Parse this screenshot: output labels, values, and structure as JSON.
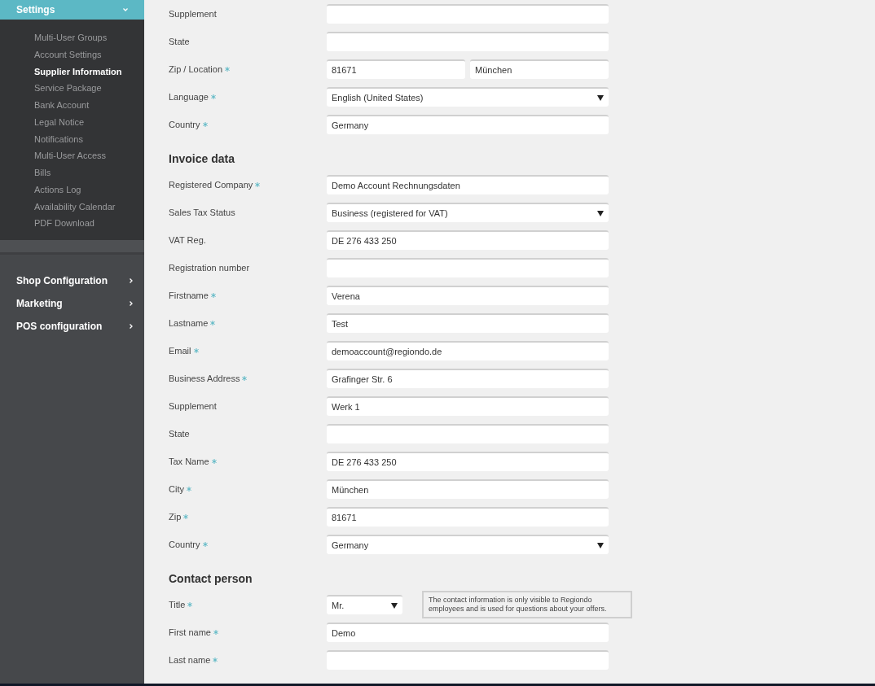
{
  "sidebar": {
    "header": {
      "label": "Settings",
      "expanded": true
    },
    "subitems": [
      {
        "label": "Multi-User Groups",
        "selected": false
      },
      {
        "label": "Account Settings",
        "selected": false
      },
      {
        "label": "Supplier Information",
        "selected": true
      },
      {
        "label": "Service Package",
        "selected": false
      },
      {
        "label": "Bank Account",
        "selected": false
      },
      {
        "label": "Legal Notice",
        "selected": false
      },
      {
        "label": "Notifications",
        "selected": false
      },
      {
        "label": "Multi-User Access",
        "selected": false
      },
      {
        "label": "Bills",
        "selected": false
      },
      {
        "label": "Actions Log",
        "selected": false
      },
      {
        "label": "Availability Calendar",
        "selected": false
      },
      {
        "label": "PDF Download",
        "selected": false
      }
    ],
    "menu": [
      {
        "label": "Shop Configuration",
        "expanded": false
      },
      {
        "label": "Marketing",
        "expanded": false
      },
      {
        "label": "POS configuration",
        "expanded": false
      }
    ]
  },
  "sections": [
    {
      "rows": [
        {
          "kind": "text",
          "label": "Supplement",
          "required": false
        },
        {
          "kind": "text",
          "label": "State",
          "required": false
        },
        {
          "kind": "split",
          "label": "Zip / Location",
          "required": true,
          "values": [
            "81671",
            "München"
          ]
        },
        {
          "kind": "select",
          "label": "Language",
          "required": true,
          "value": "English (United States)"
        },
        {
          "kind": "text",
          "label": "Country",
          "required": true,
          "value": "Germany"
        }
      ]
    },
    {
      "heading": "Invoice data",
      "rows": [
        {
          "kind": "text",
          "label": "Registered Company",
          "required": true,
          "value": "Demo Account Rechnungsdaten"
        },
        {
          "kind": "select",
          "label": "Sales Tax Status",
          "required": false,
          "value": "Business (registered for VAT)"
        },
        {
          "kind": "text",
          "label": "VAT Reg.",
          "required": false,
          "value": "DE 276 433 250"
        },
        {
          "kind": "text",
          "label": "Registration number",
          "required": false
        },
        {
          "kind": "text",
          "label": "Firstname",
          "required": true,
          "value": "Verena"
        },
        {
          "kind": "text",
          "label": "Lastname",
          "required": true,
          "value": "Test"
        },
        {
          "kind": "text",
          "label": "Email",
          "required": true,
          "value": "demoaccount@regiondo.de"
        },
        {
          "kind": "text",
          "label": "Business Address",
          "required": true,
          "value": "Grafinger Str. 6"
        },
        {
          "kind": "text",
          "label": "Supplement",
          "required": false,
          "value": "Werk 1"
        },
        {
          "kind": "text",
          "label": "State",
          "required": false
        },
        {
          "kind": "text",
          "label": "Tax Name",
          "required": true,
          "value": "DE 276 433 250"
        },
        {
          "kind": "text",
          "label": "City",
          "required": true,
          "value": "München"
        },
        {
          "kind": "text",
          "label": "Zip",
          "required": true,
          "value": "81671"
        },
        {
          "kind": "select",
          "label": "Country",
          "required": true,
          "value": "Germany"
        }
      ]
    },
    {
      "heading": "Contact person",
      "rows": [
        {
          "kind": "small-select",
          "label": "Title",
          "required": true,
          "value": "Mr.",
          "tooltip": "The contact information is only visible to Regiondo employees and is used for questions about your offers."
        },
        {
          "kind": "text",
          "label": "First name",
          "required": true,
          "value": "Demo"
        },
        {
          "kind": "text",
          "label": "Last name",
          "required": true
        }
      ]
    }
  ]
}
